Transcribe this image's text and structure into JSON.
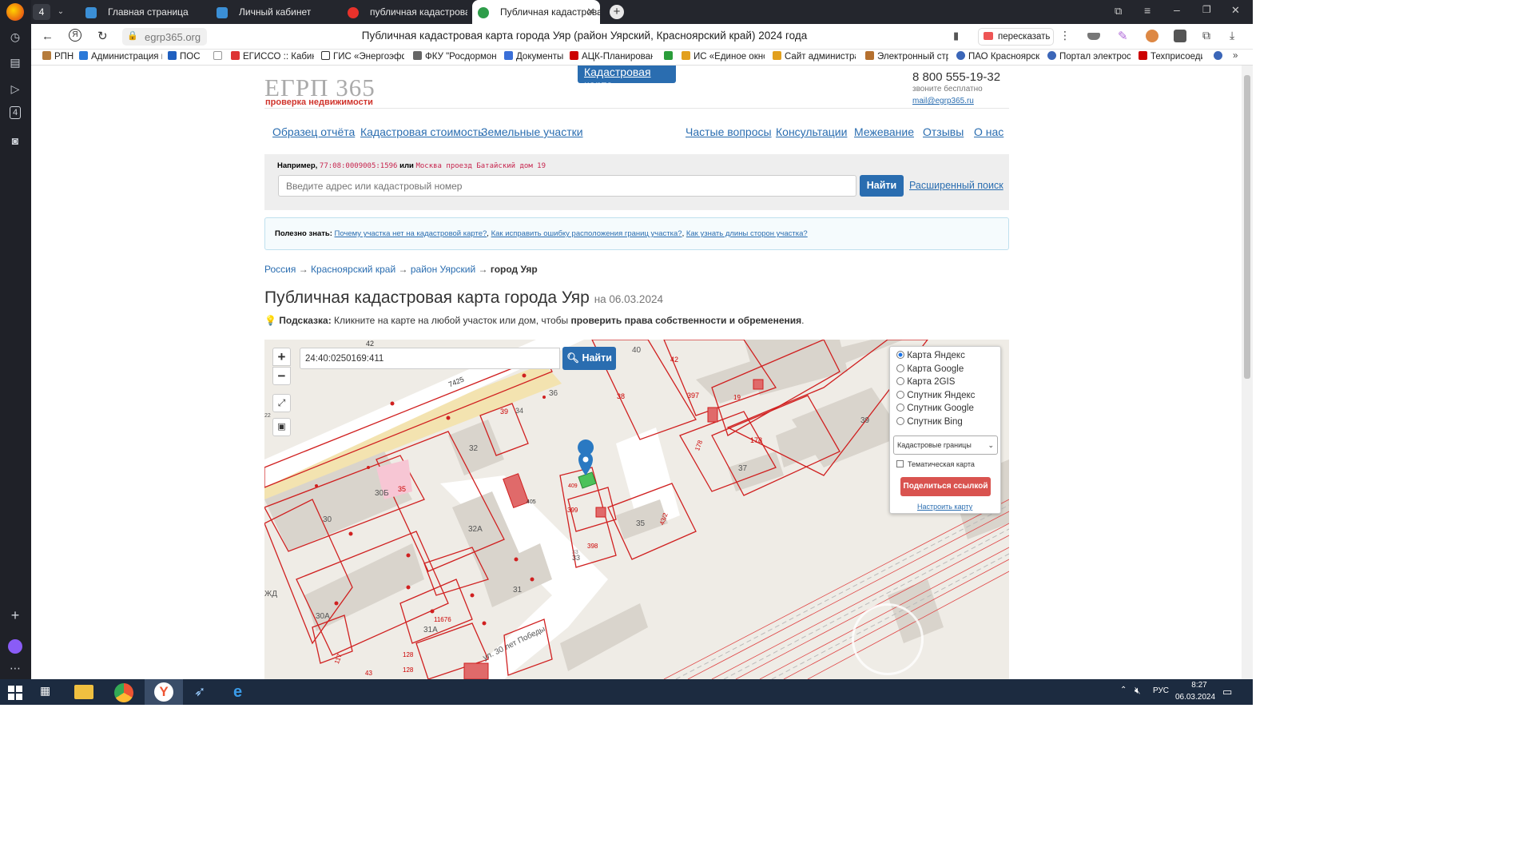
{
  "browser": {
    "tab_count": "4",
    "tabs": [
      {
        "label": "Главная страница"
      },
      {
        "label": "Личный кабинет"
      },
      {
        "label": "публичная кадастровая к"
      },
      {
        "label": "Публичная кадастрова"
      }
    ],
    "url": "egrp365.org",
    "page_title": "Публичная кадастровая карта города Уяр (район Уярский, Красноярский край) 2024 года",
    "retell_label": "пересказать",
    "bookmarks": [
      "РПН",
      "Администрация г",
      "ПОС",
      "",
      "ЕГИССО :: Кабине",
      "ГИС «Энергоэфф",
      "ФКУ \"Росдормон",
      "Документы",
      "АЦК-Планирован",
      "",
      "ИС «Единое окно",
      "Сайт администра",
      "Электронный стр",
      "ПАО Красноярскэ",
      "Портал электросе",
      "Техприсоеди"
    ]
  },
  "site": {
    "logo_main": "ЕГРП 365",
    "logo_sub": "проверка недвижимости",
    "phone": "8 800 555-19-32",
    "phone_note": "звоните бесплатно",
    "email": "mail@egrp365.ru",
    "nav": [
      "Образец отчёта",
      "Кадастровая стоимость",
      "Земельные участки",
      "Кадастровая карта",
      "Частые вопросы",
      "Консультации",
      "Межевание",
      "Отзывы",
      "О нас"
    ],
    "example_label": "Например,",
    "example_code": "77:08:0009005:1596",
    "example_or": "или",
    "example_addr": "Москва проезд Батайский дом 19",
    "search_placeholder": "Введите адрес или кадастровый номер",
    "search_button": "Найти",
    "advanced_search": "Расширенный поиск",
    "useful_label": "Полезно знать:",
    "useful_links": [
      "Почему участка нет на кадастровой карте?",
      "Как исправить ошибку расположения границ участка?",
      "Как узнать длины сторон участка?"
    ],
    "breadcrumb": [
      "Россия",
      "Красноярский край",
      "район Уярский",
      "город Уяр"
    ],
    "breadcrumb_sep": "→",
    "heading": "Публичная кадастровая карта города Уяр",
    "heading_date": "на 06.03.2024",
    "hint_label": "Подсказка:",
    "hint_text": "Кликните на карте на любой участок или дом, чтобы",
    "hint_bold": "проверить права собственности и обременения",
    "hint_end": "."
  },
  "map": {
    "search_value": "24:40:0250169:411",
    "search_button": "Найти",
    "zoom_in": "+",
    "zoom_out": "−",
    "layers": [
      "Карта Яндекс",
      "Карта Google",
      "Карта 2GIS",
      "Спутник Яндекс",
      "Спутник Google",
      "Спутник Bing"
    ],
    "selected_layer": "Карта Яндекс",
    "boundaries_select": "Кадастровые границы",
    "thematic_label": "Тематическая карта",
    "share_button": "Поделиться ссылкой",
    "configure_link": "Настроить карту",
    "labels": [
      "42",
      "40",
      "42",
      "7425",
      "36",
      "38",
      "397",
      "19",
      "178",
      "178",
      "39",
      "37",
      "39",
      "34",
      "32",
      "35",
      "30Б",
      "409",
      "405",
      "399",
      "35",
      "43/2",
      "30",
      "32А",
      "398",
      "33",
      "31",
      "ЖД",
      "30А",
      "11676",
      "31А",
      "128",
      "128",
      "117",
      "43",
      "ул. 30 лет Победы",
      "32",
      "33",
      "22"
    ]
  },
  "taskbar": {
    "lang": "РУС",
    "time": "8:27",
    "date": "06.03.2024"
  }
}
